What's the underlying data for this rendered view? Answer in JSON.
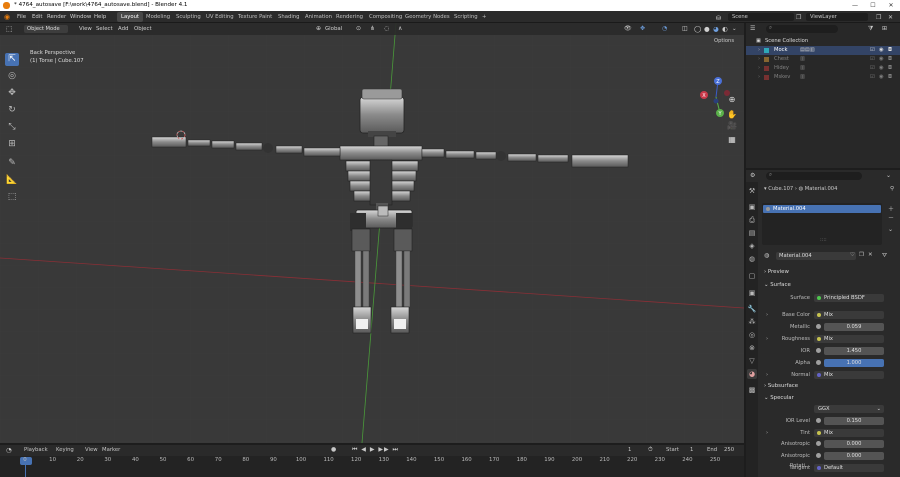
{
  "window": {
    "title": "* 4764_autosave [F:\\work\\4764_autosave.blend] - Blender 4.1"
  },
  "menu": [
    "File",
    "Edit",
    "Render",
    "Window",
    "Help"
  ],
  "workspaces": [
    "Layout",
    "Modeling",
    "Sculpting",
    "UV Editing",
    "Texture Paint",
    "Shading",
    "Animation",
    "Rendering",
    "Compositing",
    "Geometry Nodes",
    "Scripting",
    "+"
  ],
  "scene": {
    "scene_label": "Scene",
    "view_layer_label": "ViewLayer"
  },
  "viewport": {
    "mode": "Object Mode",
    "menus": [
      "View",
      "Select",
      "Add",
      "Object"
    ],
    "transform": "Global",
    "options": "Options",
    "overlay_line1": "Back Perspective",
    "overlay_line2": "(1) Torse | Cube.107",
    "gizmo": {
      "x": "X",
      "y": "Y",
      "z": "Z"
    }
  },
  "outliner": {
    "search_placeholder": "",
    "root": "Scene Collection",
    "items": [
      {
        "name": "Mock",
        "color": "#2fa8b8"
      },
      {
        "name": "Chest",
        "color": "#d69a3a"
      },
      {
        "name": "Hidey",
        "color": "#b83a3a"
      },
      {
        "name": "Mskev",
        "color": "#b83a3a"
      }
    ]
  },
  "properties": {
    "breadcrumb_object": "Cube.107",
    "breadcrumb_material": "Material.004",
    "slot": "Material.004",
    "material_name": "Material.004",
    "sections": {
      "preview": "Preview",
      "surface": "Surface",
      "subsurface": "Subsurface",
      "specular": "Specular"
    },
    "fields": [
      {
        "label": "Surface",
        "value": "Principled BSDF",
        "type": "node",
        "dot": "green"
      },
      {
        "label": "Base Color",
        "value": "Mix",
        "type": "node",
        "dot": "yellow"
      },
      {
        "label": "Metallic",
        "value": "0.059",
        "type": "num"
      },
      {
        "label": "Roughness",
        "value": "Mix",
        "type": "node",
        "dot": "yellow"
      },
      {
        "label": "IOR",
        "value": "1.450",
        "type": "num"
      },
      {
        "label": "Alpha",
        "value": "1.000",
        "type": "num"
      },
      {
        "label": "Normal",
        "value": "Mix",
        "type": "node",
        "dot": "blue"
      }
    ],
    "specular_fields": [
      {
        "label": "",
        "value": "GGX",
        "type": "select"
      },
      {
        "label": "IOR Level",
        "value": "0.150",
        "type": "num"
      },
      {
        "label": "Tint",
        "value": "Mix",
        "type": "node",
        "dot": "yellow"
      },
      {
        "label": "Anisotropic",
        "value": "0.000",
        "type": "num"
      },
      {
        "label": "Anisotropic Rotati...",
        "value": "0.000",
        "type": "num"
      },
      {
        "label": "Tangent",
        "value": "Default",
        "type": "node",
        "dot": "blue"
      }
    ]
  },
  "timeline": {
    "menus": [
      "Playback",
      "Keying",
      "View",
      "Marker"
    ],
    "current_frame": "1",
    "start_label": "Start",
    "start": "1",
    "end_label": "End",
    "end": "250",
    "ticks": [
      "0",
      "10",
      "20",
      "30",
      "40",
      "50",
      "60",
      "70",
      "80",
      "90",
      "100",
      "110",
      "120",
      "130",
      "140",
      "150",
      "160",
      "170",
      "180",
      "190",
      "200",
      "210",
      "220",
      "230",
      "240",
      "250"
    ]
  }
}
